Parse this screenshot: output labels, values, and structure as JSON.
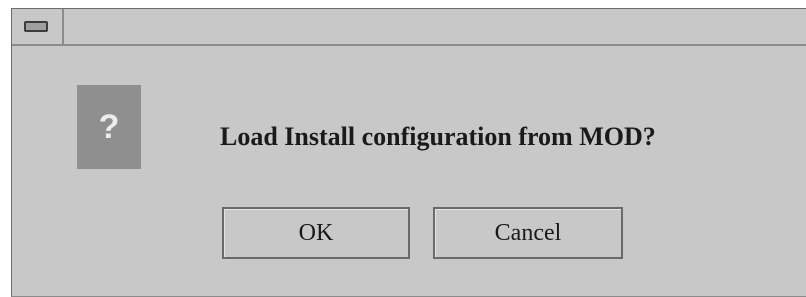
{
  "dialog": {
    "icon": "question-icon",
    "icon_glyph": "?",
    "message": "Load Install configuration from MOD?",
    "buttons": {
      "ok_label": "OK",
      "cancel_label": "Cancel"
    }
  },
  "titlebar": {
    "menu_icon": "window-menu-icon"
  }
}
